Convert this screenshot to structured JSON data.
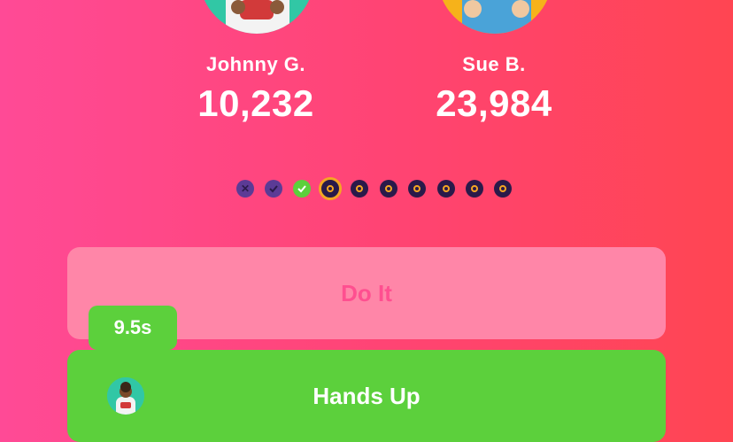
{
  "players": [
    {
      "name": "Johnny G.",
      "score": "10,232",
      "avatar_icon": "player-avatar-photo"
    },
    {
      "name": "Sue B.",
      "score": "23,984",
      "avatar_icon": "player-avatar-photo"
    }
  ],
  "progress": {
    "total_questions": 10,
    "current_index": 3,
    "states": [
      "wrong",
      "correct",
      "correct",
      "current",
      "pending",
      "pending",
      "pending",
      "pending",
      "pending",
      "pending"
    ]
  },
  "answers": [
    {
      "label": "Do It"
    },
    {
      "label": "Hands Up"
    }
  ],
  "timer": {
    "value": "9.5s"
  },
  "colors": {
    "background_start": "#ff4a96",
    "background_end": "#ff4552",
    "accent_green": "#5cd03c",
    "accent_orange": "#f5a623",
    "dot_dark": "#2a1a4a"
  }
}
